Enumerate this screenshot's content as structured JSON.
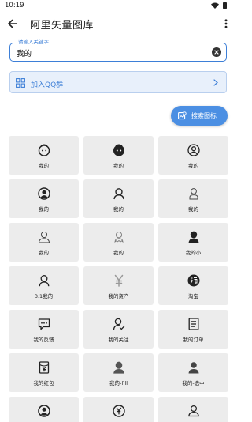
{
  "status_bar": {
    "time": "10:19"
  },
  "app_bar": {
    "title": "阿里矢量图库"
  },
  "search": {
    "label": "请输入关键字",
    "value": "我的"
  },
  "qq_group": {
    "label": "加入QQ群"
  },
  "fab": {
    "label": "搜索图标"
  },
  "accent_color": "#3d7fd7",
  "icons": [
    {
      "label": "我的",
      "icon": "round-face-icon"
    },
    {
      "label": "我的",
      "icon": "dark-face-icon"
    },
    {
      "label": "我的",
      "icon": "circle-user-icon"
    },
    {
      "label": "我的",
      "icon": "filled-circle-user-icon"
    },
    {
      "label": "我的",
      "icon": "user-outline-icon"
    },
    {
      "label": "我的",
      "icon": "user-light-icon"
    },
    {
      "label": "我的",
      "icon": "user-thin-icon"
    },
    {
      "label": "我的",
      "icon": "ghost-user-icon"
    },
    {
      "label": "我的小",
      "icon": "user-filled-icon"
    },
    {
      "label": "3.1我的",
      "icon": "user-line-icon"
    },
    {
      "label": "我的资产",
      "icon": "yen-icon"
    },
    {
      "label": "淘宝",
      "icon": "taobao-icon"
    },
    {
      "label": "我的反馈",
      "icon": "chat-bubble-icon"
    },
    {
      "label": "我的关注",
      "icon": "user-check-icon"
    },
    {
      "label": "我的订单",
      "icon": "order-list-icon"
    },
    {
      "label": "我的红包",
      "icon": "red-packet-icon"
    },
    {
      "label": "我的-fill",
      "icon": "user-fill-gray-icon"
    },
    {
      "label": "我的-选中",
      "icon": "user-selected-icon"
    },
    {
      "label": "",
      "icon": "circle-user-bold-icon"
    },
    {
      "label": "",
      "icon": "yen-circle-icon"
    },
    {
      "label": "",
      "icon": "user-outline-small-icon"
    }
  ]
}
